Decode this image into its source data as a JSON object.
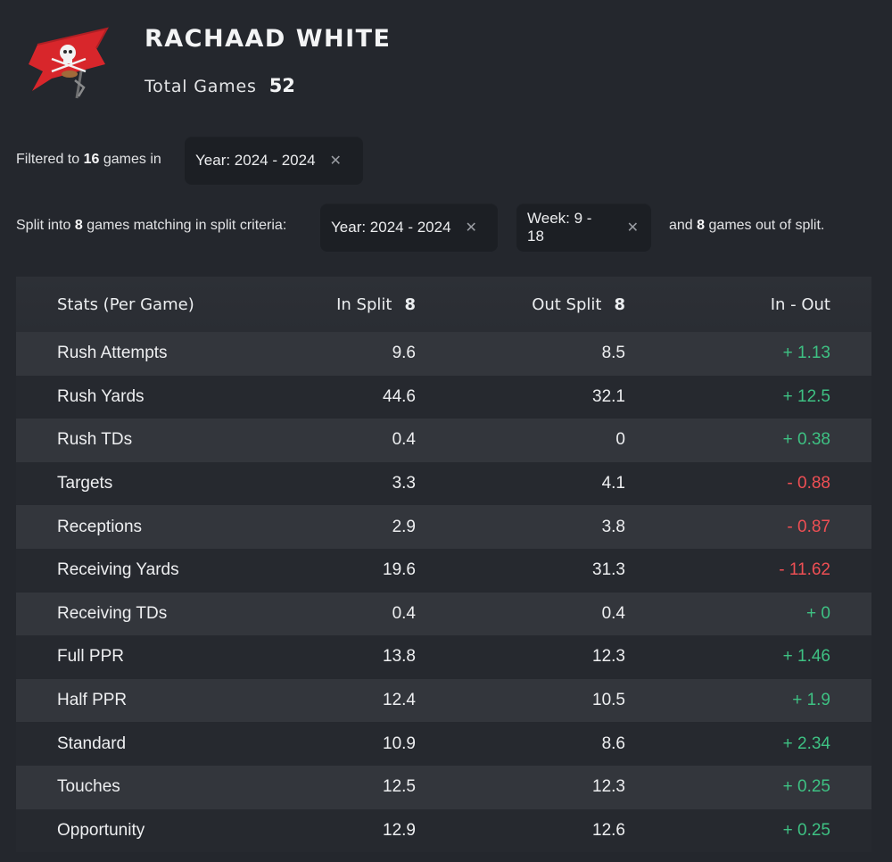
{
  "player": {
    "name": "RACHAAD WHITE",
    "total_games_label": "Total Games",
    "total_games": "52"
  },
  "filter": {
    "prefix": "Filtered to",
    "count": "16",
    "suffix": "games in",
    "chip_label": "Year: 2024 - 2024"
  },
  "split": {
    "prefix": "Split into",
    "count": "8",
    "middle": "games matching in split criteria:",
    "chips": [
      "Year: 2024 - 2024",
      "Week: 9 - 18"
    ],
    "tail_prefix": "and",
    "tail_count": "8",
    "tail_suffix": "games out of split."
  },
  "table": {
    "headers": {
      "stat": "Stats (Per Game)",
      "in_label": "In Split",
      "in_count": "8",
      "out_label": "Out Split",
      "out_count": "8",
      "diff": "In - Out"
    },
    "rows": [
      {
        "stat": "Rush Attempts",
        "in": "9.6",
        "out": "8.5",
        "diff": "+ 1.13",
        "sign": "pos"
      },
      {
        "stat": "Rush Yards",
        "in": "44.6",
        "out": "32.1",
        "diff": "+ 12.5",
        "sign": "pos"
      },
      {
        "stat": "Rush TDs",
        "in": "0.4",
        "out": "0",
        "diff": "+ 0.38",
        "sign": "pos"
      },
      {
        "stat": "Targets",
        "in": "3.3",
        "out": "4.1",
        "diff": "- 0.88",
        "sign": "neg"
      },
      {
        "stat": "Receptions",
        "in": "2.9",
        "out": "3.8",
        "diff": "- 0.87",
        "sign": "neg"
      },
      {
        "stat": "Receiving Yards",
        "in": "19.6",
        "out": "31.3",
        "diff": "- 11.62",
        "sign": "neg"
      },
      {
        "stat": "Receiving TDs",
        "in": "0.4",
        "out": "0.4",
        "diff": "+ 0",
        "sign": "pos"
      },
      {
        "stat": "Full PPR",
        "in": "13.8",
        "out": "12.3",
        "diff": "+ 1.46",
        "sign": "pos"
      },
      {
        "stat": "Half PPR",
        "in": "12.4",
        "out": "10.5",
        "diff": "+ 1.9",
        "sign": "pos"
      },
      {
        "stat": "Standard",
        "in": "10.9",
        "out": "8.6",
        "diff": "+ 2.34",
        "sign": "pos"
      },
      {
        "stat": "Touches",
        "in": "12.5",
        "out": "12.3",
        "diff": "+ 0.25",
        "sign": "pos"
      },
      {
        "stat": "Opportunity",
        "in": "12.9",
        "out": "12.6",
        "diff": "+ 0.25",
        "sign": "pos"
      }
    ]
  },
  "icons": {
    "logo": "buccaneers-flag-logo",
    "chip_remove": "close-icon"
  },
  "colors": {
    "positive": "#3ec183",
    "negative": "#ef4f54",
    "background": "#24272d"
  }
}
